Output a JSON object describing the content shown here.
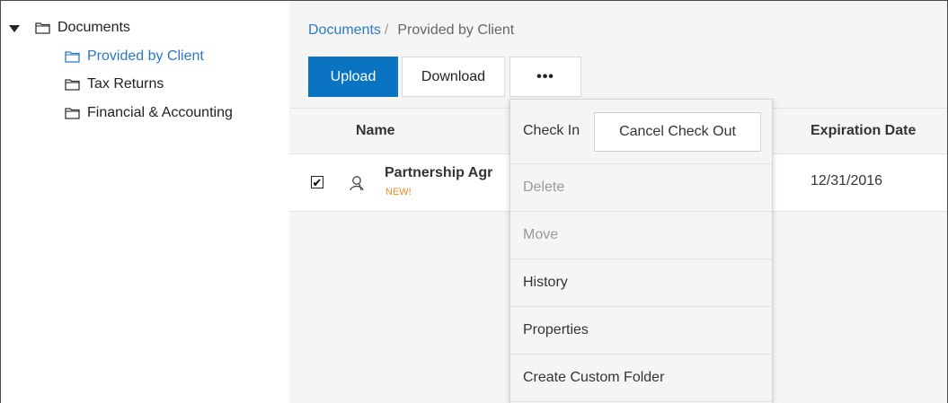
{
  "tree": {
    "root": {
      "label": "Documents",
      "icon": "folder-icon",
      "expanded": true
    },
    "children": [
      {
        "label": "Provided by Client",
        "icon": "folder-icon",
        "selected": true
      },
      {
        "label": "Tax Returns",
        "icon": "folder-icon"
      },
      {
        "label": "Financial & Accounting",
        "icon": "folder-icon"
      }
    ]
  },
  "breadcrumb": {
    "root": "Documents",
    "separator": "/",
    "current": "Provided by Client"
  },
  "toolbar": {
    "upload": "Upload",
    "download": "Download",
    "more": "•••"
  },
  "table": {
    "headers": {
      "name": "Name",
      "expiration": "Expiration Date"
    },
    "rows": [
      {
        "checked": true,
        "checkmark": "✔",
        "name": "Partnership Agr",
        "badge": "NEW!",
        "expiration": "12/31/2016"
      }
    ]
  },
  "menu": {
    "check_in": "Check In",
    "cancel_check_out": "Cancel Check Out",
    "items": [
      {
        "label": "Delete",
        "disabled": true
      },
      {
        "label": "Move",
        "disabled": true
      },
      {
        "label": "History",
        "disabled": false
      },
      {
        "label": "Properties",
        "disabled": false
      },
      {
        "label": "Create Custom Folder",
        "disabled": false
      }
    ]
  },
  "colors": {
    "accent": "#0a74c3",
    "link": "#2a79c3",
    "badge": "#f08a24"
  }
}
